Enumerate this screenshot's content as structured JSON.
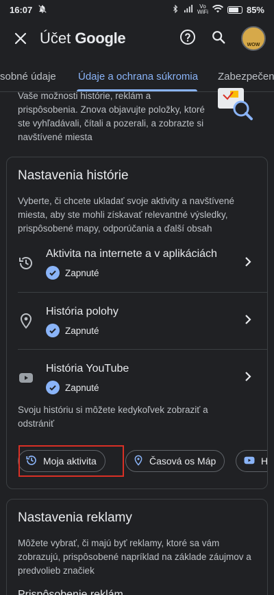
{
  "status_bar": {
    "time": "16:07",
    "volte_label": "Vo\nWiFi",
    "battery_percent": "85%"
  },
  "appbar": {
    "title_prefix": "Účet",
    "title_brand": "Google",
    "avatar_text": "WOW"
  },
  "tabs": [
    {
      "label": "Osobné údaje",
      "visible_label": "sobné údaje",
      "active": false
    },
    {
      "label": "Údaje a ochrana súkromia",
      "active": true
    },
    {
      "label": "Zabezpečenie",
      "visible_label": "Zabezpečen",
      "active": false
    }
  ],
  "intro_text": "Vaše možnosti histórie, reklám a prispôsobenia. Znova objavujte položky, ktoré ste vyhľadávali, čítali a pozerali, a zobrazte si navštívené miesta",
  "history_card": {
    "title": "Nastavenia histórie",
    "description": "Vyberte, či chcete ukladať svoje aktivity a navštívené miesta, aby ste mohli získavať relevantné výsledky, prispôsobené mapy, odporúčania a ďalší obsah",
    "rows": [
      {
        "title": "Aktivita na internete a v aplikáciách",
        "status": "Zapnuté",
        "icon": "history-icon"
      },
      {
        "title": "História polohy",
        "status": "Zapnuté",
        "icon": "location-pin-icon"
      },
      {
        "title": "História YouTube",
        "status": "Zapnuté",
        "icon": "youtube-icon"
      }
    ],
    "footer": "Svoju históriu si môžete kedykoľvek zobraziť a odstrániť",
    "chips": [
      {
        "label": "Moja aktivita",
        "icon": "history-icon"
      },
      {
        "label": "Časová os Máp",
        "icon": "location-pin-icon"
      },
      {
        "label": "História YouTube",
        "visible_label": "His",
        "icon": "youtube-icon"
      }
    ]
  },
  "ads_card": {
    "title": "Nastavenia reklamy",
    "description": "Môžete vybrať, či majú byť reklamy, ktoré sa vám zobrazujú, prispôsobené napríklad na základe záujmov a predvolieb značiek",
    "next_item": "Prispôsobenie reklám"
  },
  "colors": {
    "background": "#202124",
    "accent": "#8ab4f8",
    "highlight": "#d93025"
  }
}
